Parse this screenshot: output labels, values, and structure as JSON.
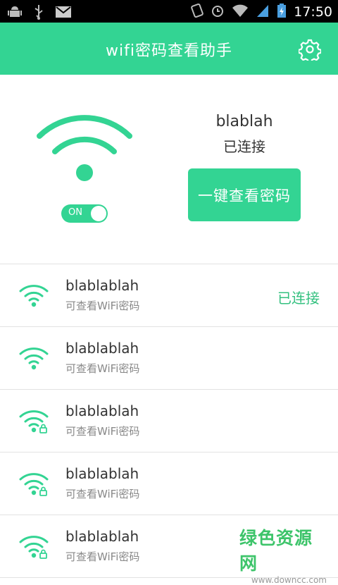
{
  "status_bar": {
    "time": "17:50",
    "left_icons": [
      "android-debug-icon",
      "usb-icon",
      "gmail-icon"
    ],
    "right_icons": [
      "rotate-icon",
      "alarm-icon",
      "wifi-signal-icon",
      "cell-signal-icon",
      "battery-charging-icon"
    ]
  },
  "app_bar": {
    "title": "wifi密码查看助手",
    "settings_icon": "gear-icon"
  },
  "current": {
    "name": "blablah",
    "status": "已连接",
    "toggle_label": "ON",
    "toggle_on": true,
    "view_button": "一键查看密码"
  },
  "networks": [
    {
      "name": "blablablah",
      "sub": "可查看WiFi密码",
      "status": "已连接",
      "locked": false
    },
    {
      "name": "blablablah",
      "sub": "可查看WiFi密码",
      "status": "",
      "locked": false
    },
    {
      "name": "blablablah",
      "sub": "可查看WiFi密码",
      "status": "",
      "locked": true
    },
    {
      "name": "blablablah",
      "sub": "可查看WiFi密码",
      "status": "",
      "locked": true
    },
    {
      "name": "blablablah",
      "sub": "可查看WiFi密码",
      "status": "",
      "locked": true
    }
  ],
  "watermark": {
    "main": "绿色资源网",
    "sub": "www.downcc.com"
  },
  "colors": {
    "accent": "#33d493",
    "status_text": "#33c07f"
  }
}
